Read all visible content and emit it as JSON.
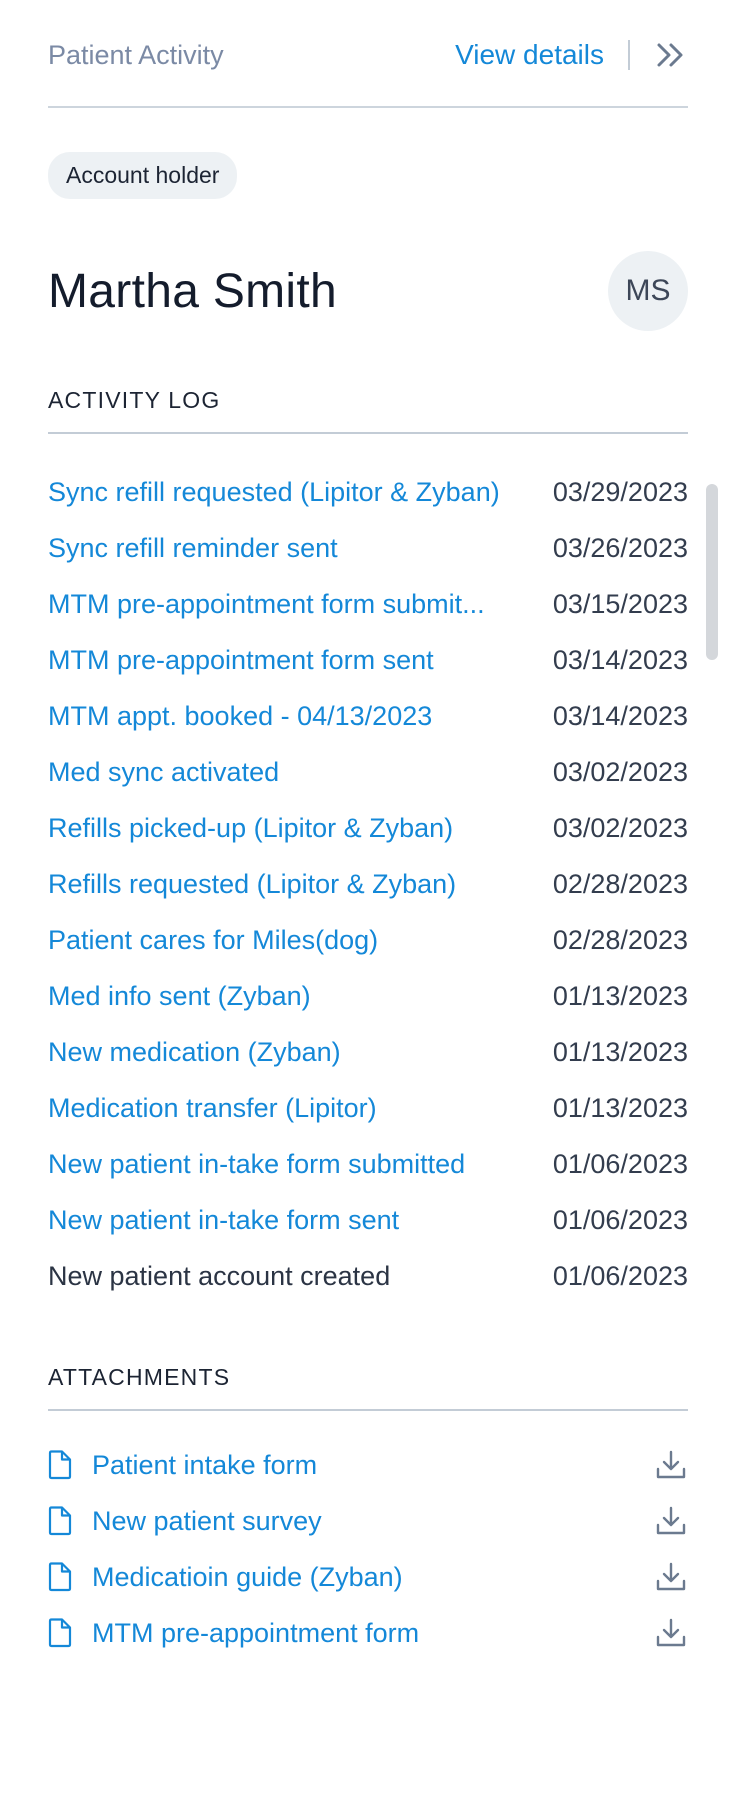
{
  "header": {
    "title": "Patient Activity",
    "view_details_label": "View details",
    "expand_icon": "double-chevron-right-icon"
  },
  "account": {
    "badge_label": "Account holder",
    "name": "Martha Smith",
    "initials": "MS"
  },
  "activity_log": {
    "title": "ACTIVITY LOG",
    "entries": [
      {
        "label": "Sync refill requested (Lipitor & Zyban)",
        "date": "03/29/2023"
      },
      {
        "label": "Sync refill reminder sent",
        "date": "03/26/2023"
      },
      {
        "label": "MTM pre-appointment form submit...",
        "date": "03/15/2023"
      },
      {
        "label": "MTM pre-appointment form sent",
        "date": "03/14/2023"
      },
      {
        "label": "MTM appt. booked - 04/13/2023",
        "date": "03/14/2023"
      },
      {
        "label": "Med sync activated",
        "date": "03/02/2023"
      },
      {
        "label": "Refills picked-up (Lipitor & Zyban)",
        "date": "03/02/2023"
      },
      {
        "label": "Refills requested (Lipitor & Zyban)",
        "date": "02/28/2023"
      },
      {
        "label": "Patient cares for Miles(dog)",
        "date": "02/28/2023"
      },
      {
        "label": "Med info sent (Zyban)",
        "date": "01/13/2023"
      },
      {
        "label": "New medication (Zyban)",
        "date": "01/13/2023"
      },
      {
        "label": "Medication transfer (Lipitor)",
        "date": "01/13/2023"
      },
      {
        "label": "New patient in-take form submitted",
        "date": "01/06/2023"
      },
      {
        "label": "New patient in-take form sent",
        "date": "01/06/2023"
      },
      {
        "label": "New patient account created",
        "date": "01/06/2023"
      }
    ]
  },
  "attachments": {
    "title": "ATTACHMENTS",
    "file_icon": "document-icon",
    "download_icon": "download-icon",
    "items": [
      {
        "label": "Patient intake form"
      },
      {
        "label": "New patient survey"
      },
      {
        "label": "Medicatioin guide (Zyban)"
      },
      {
        "label": "MTM pre-appointment form"
      }
    ]
  },
  "colors": {
    "link": "#1488d8",
    "muted_title": "#7b8aa5",
    "text": "#141c2c",
    "badge_bg": "#edf1f4",
    "divider": "#c3ccd6"
  }
}
